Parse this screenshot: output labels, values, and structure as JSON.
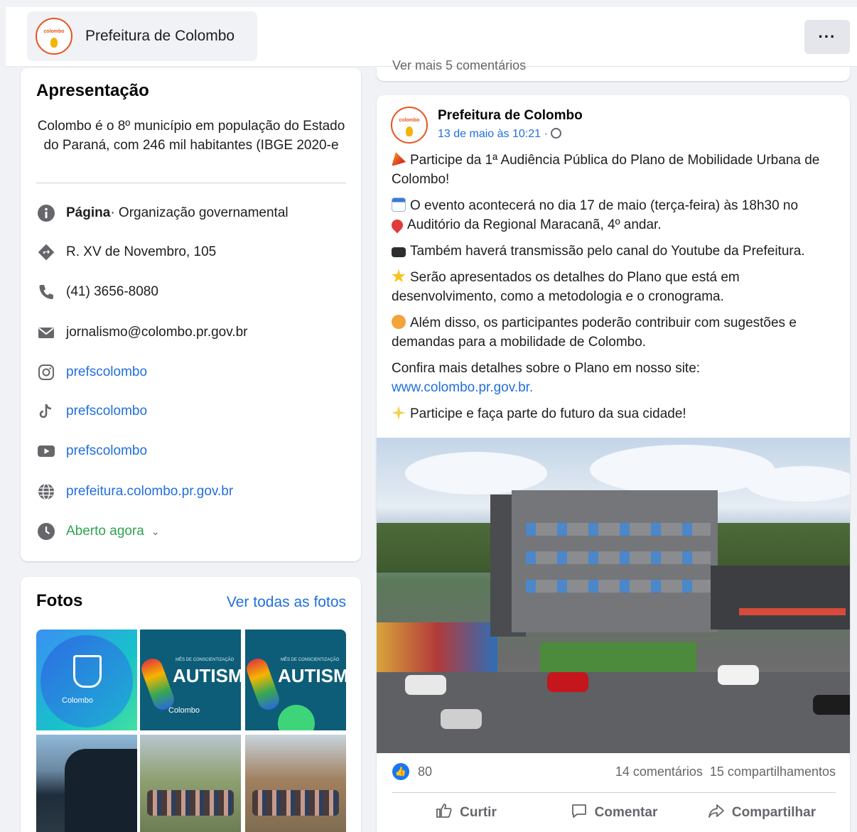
{
  "header": {
    "page_name": "Prefeitura de Colombo",
    "more_label": "···",
    "logo_text": "colombo"
  },
  "intro": {
    "title": "Apresentação",
    "description": "Colombo é o 8º município em população do Estado do Paraná, com 246 mil habitantes (IBGE 2020-e",
    "category_bold": "Página",
    "category_rest": " · Organização governamental",
    "address": "R. XV de Novembro, 105",
    "phone": "(41) 3656-8080",
    "email": "jornalismo@colombo.pr.gov.br",
    "instagram": "prefscolombo",
    "tiktok": "prefscolombo",
    "youtube": "prefscolombo",
    "website": "prefeitura.colombo.pr.gov.br",
    "hours": "Aberto agora"
  },
  "photos": {
    "title": "Fotos",
    "see_all": "Ver todas as fotos",
    "thumb1_caption": "Colombo",
    "thumb_autismo": "AUTISMO",
    "thumb_autismo_top": "MÊS DE CONSCIENTIZAÇÃO",
    "thumb_brand": "Colombo"
  },
  "previous_post": {
    "comments_link": "Ver mais 5 comentários"
  },
  "post": {
    "author": "Prefeitura de Colombo",
    "date": "13 de maio às 10:21 ·",
    "lines": {
      "l1": "Participe da 1ª Audiência Pública do Plano de Mobilidade Urbana de Colombo!",
      "l2": "O evento acontecerá no dia 17 de maio (terça-feira) às 18h30 no",
      "l3": "Auditório da Regional Maracanã, 4º andar.",
      "l4": "Também haverá transmissão pelo canal do Youtube da Prefeitura.",
      "l5": "Serão apresentados os detalhes do Plano que está em desenvolvimento, como a metodologia e o cronograma.",
      "l6": "Além disso, os participantes poderão contribuir com sugestões e demandas para a mobilidade de Colombo.",
      "l7": "Confira mais detalhes sobre o Plano em nosso site:",
      "l7_link": "www.colombo.pr.gov.br.",
      "l8": "Participe e faça parte do futuro da sua cidade!"
    },
    "reactions": "80",
    "comments": "14 comentários",
    "shares": "15 compartilhamentos",
    "actions": {
      "like": "Curtir",
      "comment": "Comentar",
      "share": "Compartilhar"
    }
  },
  "colors": {
    "link": "#216fdb",
    "like_blue": "#1877f2",
    "open_green": "#31a24c",
    "background": "#f0f2f5"
  },
  "icons": [
    "info-icon",
    "directions-icon",
    "phone-icon",
    "mail-icon",
    "instagram-icon",
    "tiktok-icon",
    "youtube-icon",
    "globe-icon",
    "clock-icon",
    "like-icon",
    "comment-icon",
    "share-icon"
  ]
}
